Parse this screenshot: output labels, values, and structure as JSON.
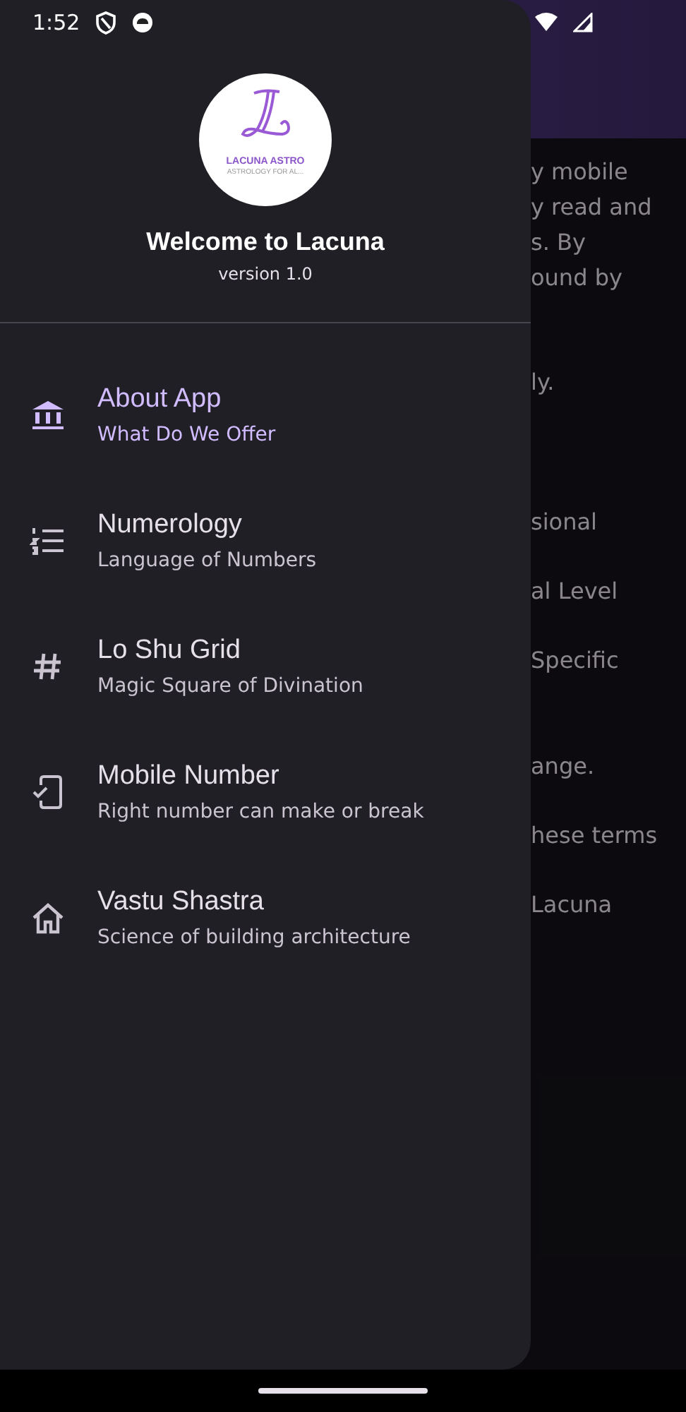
{
  "status_bar": {
    "time": "1:52"
  },
  "background_lines": [
    "y mobile",
    "y read and",
    "s. By",
    "ound by",
    "ly.",
    "sional",
    "al Level",
    "Specific",
    "ange.",
    "hese terms",
    "Lacuna"
  ],
  "drawer": {
    "logo": {
      "title": "LACUNA ASTRO",
      "tagline": "ASTROLOGY FOR AL..."
    },
    "title": "Welcome to Lacuna",
    "version": "version 1.0",
    "items": [
      {
        "kind": "bank",
        "title": "About App",
        "subtitle": "What Do We Offer",
        "selected": true
      },
      {
        "kind": "list",
        "title": "Numerology",
        "subtitle": "Language of Numbers",
        "selected": false
      },
      {
        "kind": "hash",
        "title": "Lo Shu Grid",
        "subtitle": "Magic Square of Divination",
        "selected": false
      },
      {
        "kind": "phone",
        "title": "Mobile Number",
        "subtitle": "Right number can make or break",
        "selected": false
      },
      {
        "kind": "house",
        "title": "Vastu Shastra",
        "subtitle": "Science of building architecture",
        "selected": false
      }
    ]
  }
}
